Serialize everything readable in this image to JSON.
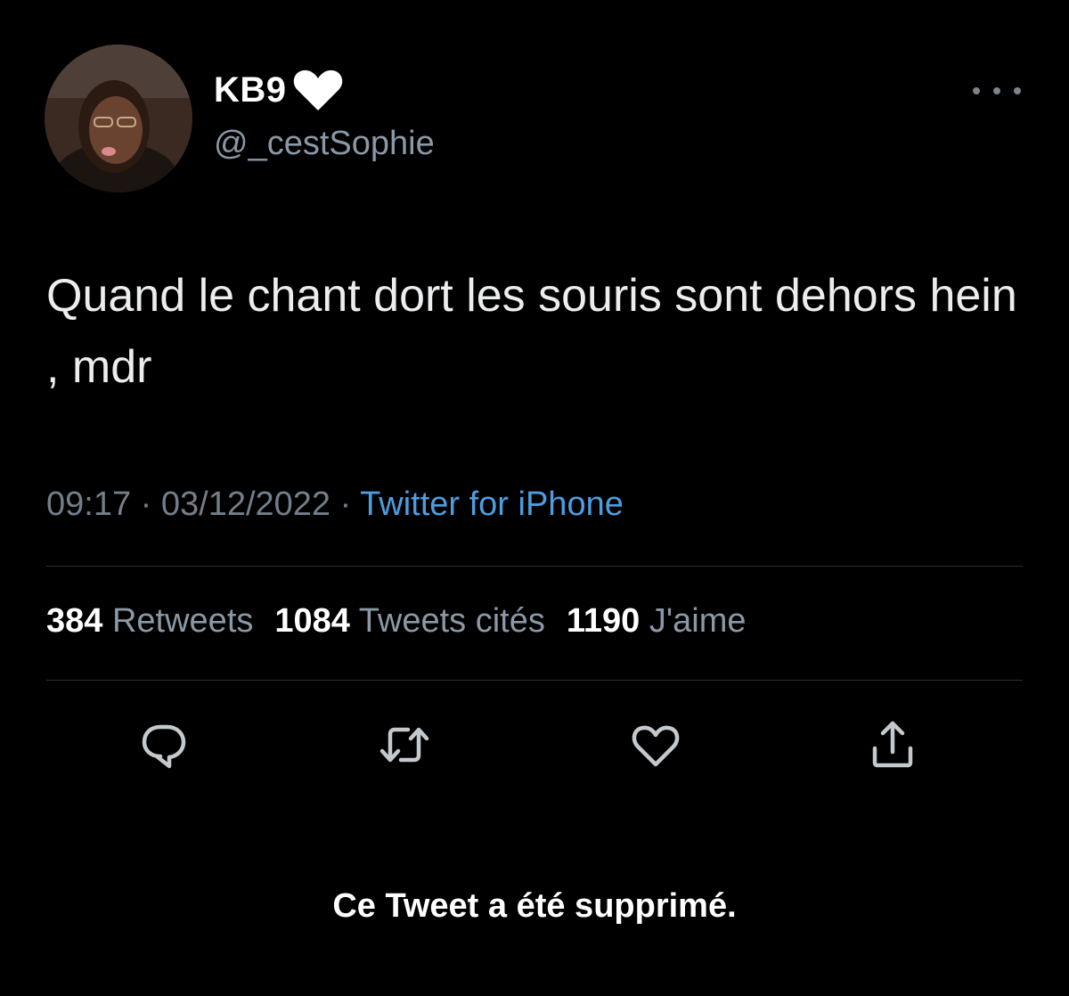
{
  "author": {
    "display_name": "KB9",
    "badge_icon": "heart-icon",
    "handle": "@_cestSophie",
    "avatar_icon": "avatar"
  },
  "tweet": {
    "text": "Quand le chant dort les souris sont dehors hein , mdr",
    "time": "09:17",
    "date": "03/12/2022",
    "separator": "·",
    "source": "Twitter for iPhone"
  },
  "stats": {
    "retweets_count": "384",
    "retweets_label": "Retweets",
    "quotes_count": "1084",
    "quotes_label": "Tweets cités",
    "likes_count": "1190",
    "likes_label": "J'aime"
  },
  "actions": {
    "reply_icon": "reply-icon",
    "retweet_icon": "retweet-icon",
    "like_icon": "heart-icon",
    "share_icon": "share-icon"
  },
  "footer": {
    "notice": "Ce Tweet a été supprimé."
  },
  "colors": {
    "background": "#000000",
    "text_primary": "#ffffff",
    "text_secondary": "#8b98a5",
    "link": "#4d9de0"
  }
}
